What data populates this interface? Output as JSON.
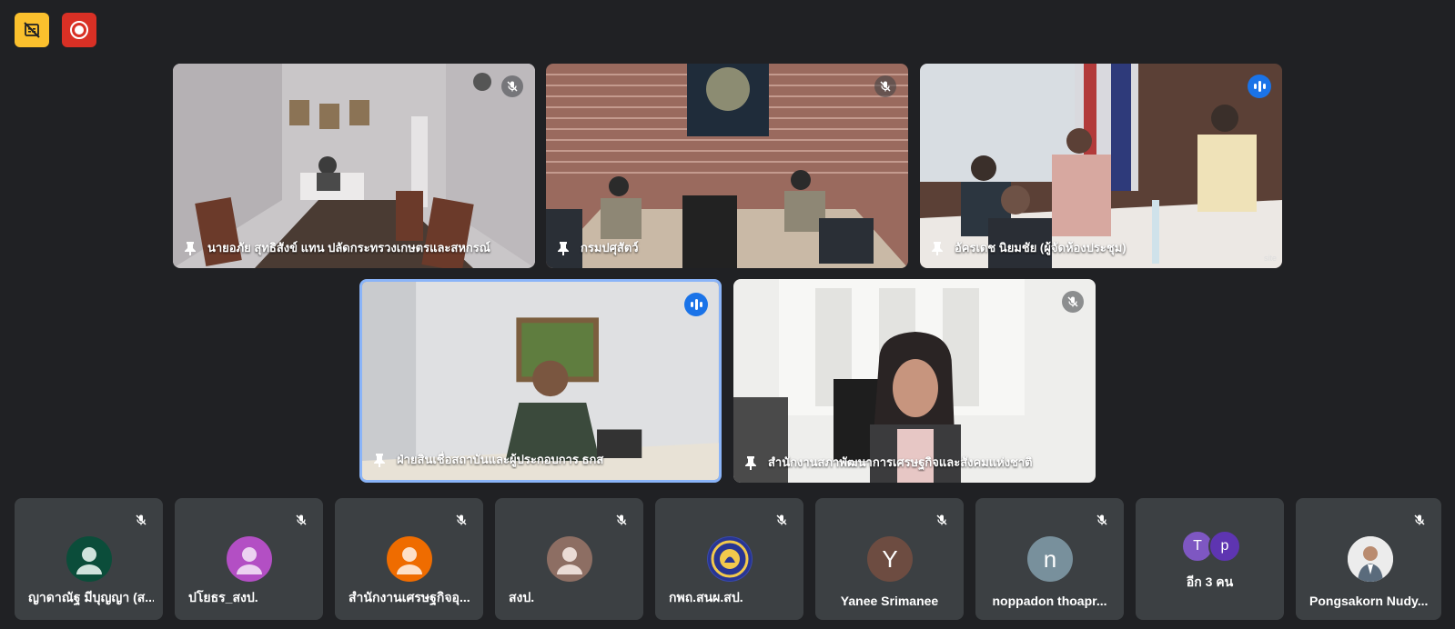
{
  "toolbar": {
    "captions_icon": "captions-off-icon",
    "record_icon": "recording-icon",
    "captions_color": "#fbc02d",
    "record_color": "#d93025"
  },
  "video_tiles": [
    {
      "name": "นายอภัย สุทธิสังข์ แทน ปลัดกระทรวงเกษตรและสหกรณ์",
      "status": "muted"
    },
    {
      "name": "กรมปศุสัตว์",
      "status": "muted"
    },
    {
      "name": "อัครเดช นิยมชัย (ผู้จัดห้องประชุม)",
      "status": "speaking",
      "watermark": "site"
    },
    {
      "name": "ฝ่ายสินเชื่อสถาบันและผู้ประกอบการ ธกส",
      "status": "speaking"
    },
    {
      "name": "สำนักงานสภาพัฒนาการเศรษฐกิจและสังคมแห่งชาติ",
      "status": "muted"
    }
  ],
  "participants": [
    {
      "name": "ญาดาณัฐ มีบุญญา (ส...",
      "avatar_color": "#0b4d3a",
      "avatar_type": "person-icon"
    },
    {
      "name": "ปโยธร_สงป.",
      "avatar_color": "#b34fc4",
      "avatar_type": "person-icon"
    },
    {
      "name": "สำนักงานเศรษฐกิจอุ...",
      "avatar_color": "#ef6c00",
      "avatar_type": "person-icon"
    },
    {
      "name": "สงป.",
      "avatar_color": "#8d6e63",
      "avatar_type": "person-icon"
    },
    {
      "name": "กพถ.สนผ.สป.",
      "avatar_color": "#3949ab",
      "avatar_type": "emblem-icon"
    },
    {
      "name": "Yanee Srimanee",
      "avatar_color": "#6d4c41",
      "initial": "Y"
    },
    {
      "name": "noppadon thoapr...",
      "avatar_color": "#78909c",
      "initial": "n"
    },
    {
      "name": "อีก 3 คน",
      "more": [
        "T",
        "p"
      ],
      "more_colors": [
        "#7e57c2",
        "#5e35b1"
      ]
    },
    {
      "name": "Pongsakorn Nudy...",
      "avatar_color": "#e0e0e0",
      "avatar_type": "photo-avatar"
    }
  ]
}
